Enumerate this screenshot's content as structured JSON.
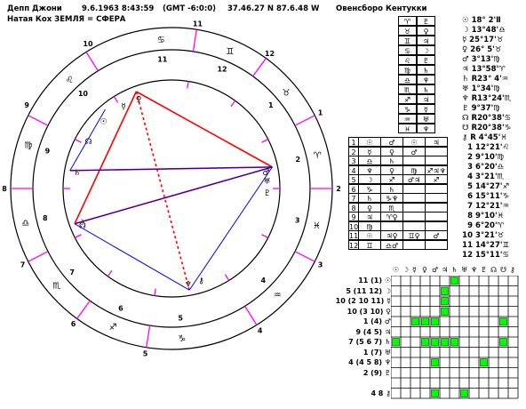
{
  "header": {
    "name": "Депп Джони",
    "datetime": "9.6.1963 8:43:59",
    "gmt": "(GMT -6:0:0)",
    "coords": "37.46.27 N  87.6.48 W",
    "place": "Овенсборо Кентукки",
    "line2": "Натая  Кох ЗЕМЛЯ = СФЕРА"
  },
  "wheel": {
    "outer_numbers": [
      "10",
      "9",
      "8",
      "7",
      "6",
      "5",
      "4",
      "3",
      "2",
      "1",
      "12",
      "11"
    ],
    "inner_numbers": [
      "10",
      "9",
      "8",
      "7",
      "6",
      "5",
      "4",
      "3",
      "2",
      "1",
      "12",
      "11"
    ]
  },
  "planets": [
    {
      "sym": "☉",
      "pos": "18° 2'Ⅱ"
    },
    {
      "sym": "☽",
      "pos": "13°48'♎"
    },
    {
      "sym": "☿",
      "pos": "25°17'♉"
    },
    {
      "sym": "♀",
      "pos": "26° 5'♉"
    },
    {
      "sym": "♂",
      "pos": "3°13'♍"
    },
    {
      "sym": "♃",
      "pos": "13°58'♈"
    },
    {
      "sym": "♄",
      "pos": "R23° 4'♒"
    },
    {
      "sym": "♅",
      "pos": "1°34'♍"
    },
    {
      "sym": "♆",
      "pos": "R13°24'♏"
    },
    {
      "sym": "♇",
      "pos": "9°37'♍"
    },
    {
      "sym": "☊",
      "pos": "R20°38'♋"
    },
    {
      "sym": "☋",
      "pos": "R20°38'♑"
    },
    {
      "sym": "⚷",
      "pos": "R 4°45'♓"
    }
  ],
  "houses": [
    {
      "n": "1",
      "pos": "12°21'♌"
    },
    {
      "n": "2",
      "pos": "9°10'♍"
    },
    {
      "n": "3",
      "pos": "6°20'♎"
    },
    {
      "n": "4",
      "pos": "3°21'♏"
    },
    {
      "n": "5",
      "pos": "14°27'♐"
    },
    {
      "n": "6",
      "pos": "15°11'♑"
    },
    {
      "n": "7",
      "pos": "12°21'♒"
    },
    {
      "n": "8",
      "pos": "9°10'♓"
    },
    {
      "n": "9",
      "pos": "6°20'♈"
    },
    {
      "n": "10",
      "pos": "3°21'♉"
    },
    {
      "n": "11",
      "pos": "14°27'♊"
    },
    {
      "n": "12",
      "pos": "15°11'♋"
    }
  ],
  "sign_rulers": [
    [
      "♈",
      "♇"
    ],
    [
      "♉",
      "♀"
    ],
    [
      "♊",
      "♃"
    ],
    [
      "♋",
      "☽"
    ],
    [
      "♌",
      "♇"
    ],
    [
      "♍",
      "♄"
    ],
    [
      "♎",
      "♆"
    ],
    [
      "♏",
      "♄"
    ],
    [
      "♐",
      "♃"
    ],
    [
      "♑",
      "☿"
    ],
    [
      "♒",
      "♅"
    ],
    [
      "♓",
      "♆"
    ]
  ],
  "house_table": [
    {
      "n": "1",
      "cells": [
        "☉",
        "♂",
        "☉",
        "♃"
      ]
    },
    {
      "n": "2",
      "cells": [
        "☿",
        "♀",
        "♂",
        ""
      ]
    },
    {
      "n": "3",
      "cells": [
        "♎",
        "♄",
        "",
        ""
      ]
    },
    {
      "n": "4",
      "cells": [
        "♆",
        "♀",
        "♍",
        "♐♃♆"
      ]
    },
    {
      "n": "5",
      "cells": [
        "☽",
        "♐",
        "♂♃",
        "♐"
      ]
    },
    {
      "n": "6",
      "cells": [
        "♑",
        "♄",
        "",
        ""
      ]
    },
    {
      "n": "7",
      "cells": [
        "♄",
        "♑♆",
        "",
        ""
      ]
    },
    {
      "n": "8",
      "cells": [
        "♀",
        "♏",
        "",
        ""
      ]
    },
    {
      "n": "9",
      "cells": [
        "♃",
        "♈♀",
        "",
        ""
      ]
    },
    {
      "n": "10",
      "cells": [
        "♍",
        "",
        "",
        ""
      ]
    },
    {
      "n": "11",
      "cells": [
        "☉",
        "♃♀",
        "♊♀",
        "♂"
      ]
    },
    {
      "n": "12",
      "cells": [
        "♊",
        "♎♂",
        "",
        ""
      ]
    }
  ],
  "aspect_labels": [
    "11 (1) ☉",
    "5 (11 12) ☽",
    "10 (2 10 11) ☿",
    "10 (3 10) ♀",
    "1 (4) ♂",
    "9 (4 5) ♃",
    "7 (5 6 7) ♄",
    "1 (7) ♅",
    "4 (4 5 8) ♆",
    "2 (9) ♇",
    "",
    "4 8 ⚷"
  ],
  "aspect_head": [
    "☉",
    "☽",
    "☿",
    "♀",
    "♂",
    "♃",
    "♄",
    "♅",
    "♆",
    "♇",
    "☊",
    "☋",
    "⚷"
  ],
  "colors": {
    "red": "#ff0000",
    "blue": "#0000ff",
    "magenta": "#ff00ff",
    "green": "#00ff00"
  }
}
